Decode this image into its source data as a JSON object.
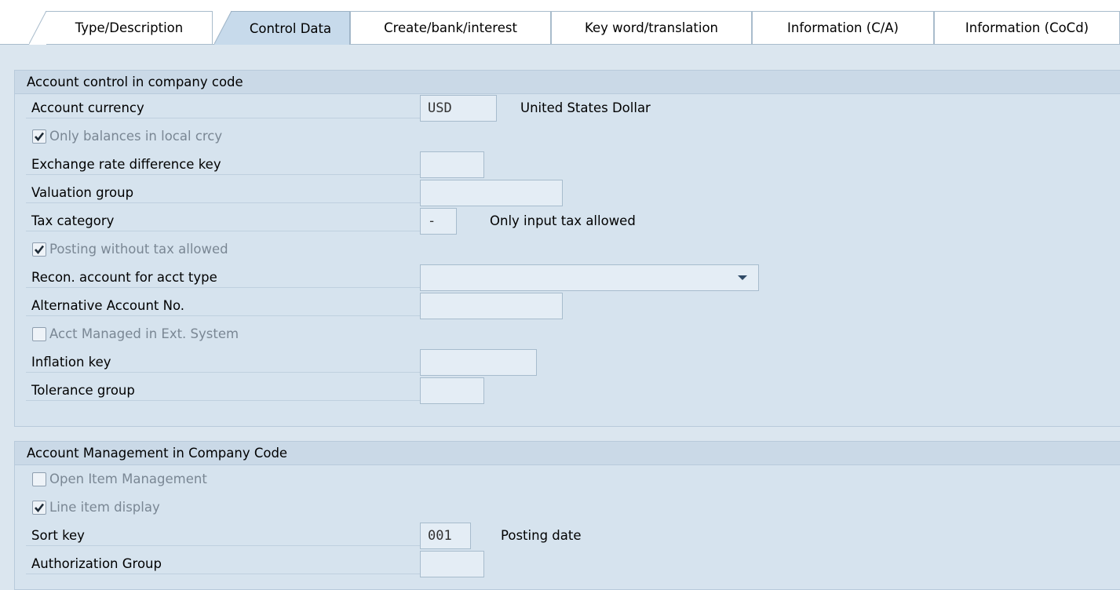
{
  "tabs": [
    {
      "label": "Type/Description",
      "active": false
    },
    {
      "label": "Control Data",
      "active": true
    },
    {
      "label": "Create/bank/interest",
      "active": false
    },
    {
      "label": "Key word/translation",
      "active": false
    },
    {
      "label": "Information (C/A)",
      "active": false
    },
    {
      "label": "Information (CoCd)",
      "active": false
    }
  ],
  "account_control": {
    "title": "Account control in company code",
    "account_currency": {
      "label": "Account currency",
      "value": "USD",
      "description": "United States Dollar"
    },
    "only_balances_local": {
      "label": "Only balances in local crcy",
      "checked": true
    },
    "exchange_rate_key": {
      "label": "Exchange rate difference key",
      "value": ""
    },
    "valuation_group": {
      "label": "Valuation group",
      "value": ""
    },
    "tax_category": {
      "label": "Tax category",
      "value": "-",
      "description": "Only input tax allowed"
    },
    "posting_without_tax": {
      "label": "Posting without tax allowed",
      "checked": true
    },
    "recon_account": {
      "label": "Recon. account for acct type",
      "value": ""
    },
    "alternative_account": {
      "label": "Alternative Account No.",
      "value": ""
    },
    "acct_managed_ext": {
      "label": "Acct Managed in Ext. System",
      "checked": false
    },
    "inflation_key": {
      "label": "Inflation key",
      "value": ""
    },
    "tolerance_group": {
      "label": "Tolerance group",
      "value": ""
    }
  },
  "account_management": {
    "title": "Account Management in Company Code",
    "open_item_mgmt": {
      "label": "Open Item Management",
      "checked": false
    },
    "line_item_display": {
      "label": "Line item display",
      "checked": true
    },
    "sort_key": {
      "label": "Sort key",
      "value": "001",
      "description": "Posting date"
    },
    "authorization_group": {
      "label": "Authorization Group",
      "value": ""
    }
  },
  "colors": {
    "active_tab": "#c7daeb",
    "panel_background": "#d6e3ee",
    "field_background": "#e4edf5"
  }
}
